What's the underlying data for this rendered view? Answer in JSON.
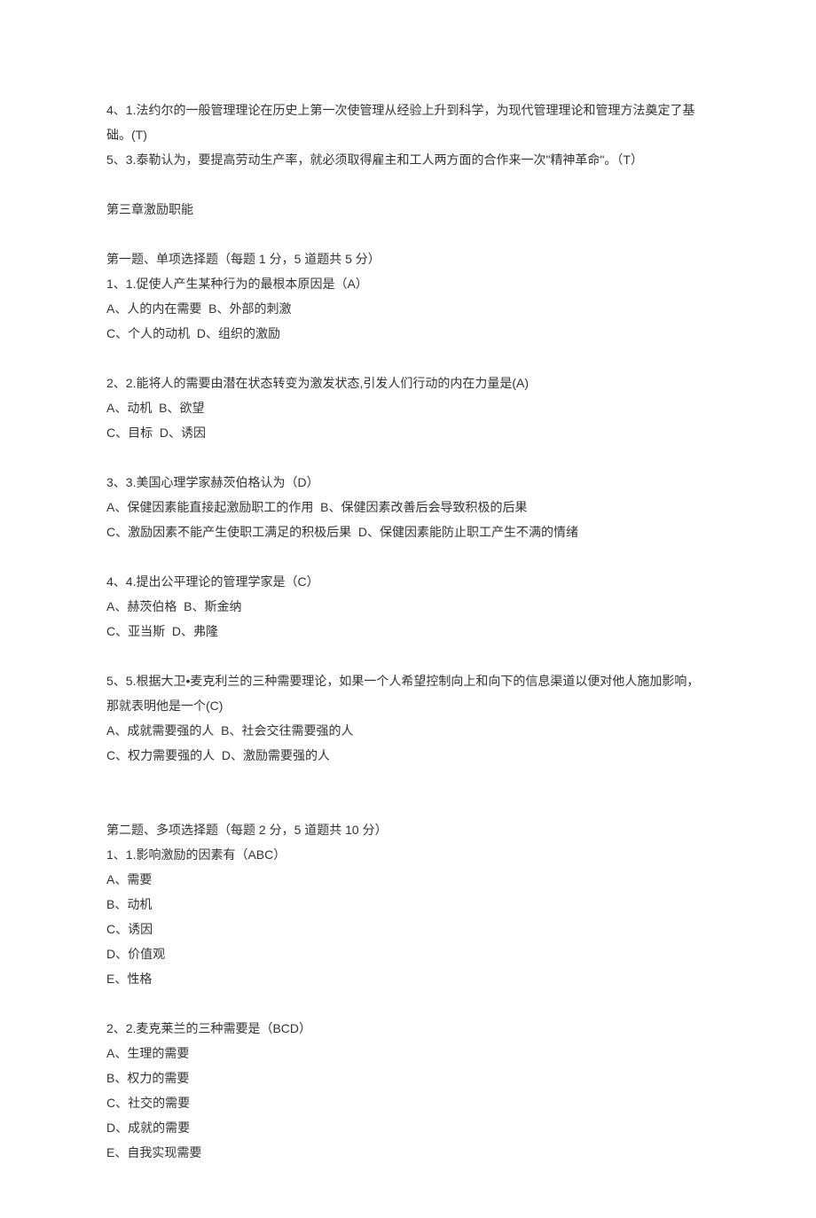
{
  "intro_lines": [
    "4、1.法约尔的一般管理理论在历史上第一次使管理从经验上升到科学，为现代管理理论和管理方法奠定了基础。(T)",
    "5、3.泰勒认为，要提高劳动生产率，就必须取得雇主和工人两方面的合作来一次\"精神革命\"。（T）"
  ],
  "chapter_title": "第三章激励职能",
  "section1": {
    "heading": "第一题、单项选择题（每题 1 分，5 道题共 5 分）",
    "q1": [
      "1、1.促使人产生某种行为的最根本原因是（A）",
      "A、人的内在需要  B、外部的刺激",
      "C、个人的动机  D、组织的激励"
    ],
    "q2": [
      "2、2.能将人的需要由潜在状态转变为激发状态,引发人们行动的内在力量是(A)",
      "A、动机  B、欲望",
      "C、目标  D、诱因"
    ],
    "q3": [
      "3、3.美国心理学家赫茨伯格认为（D）",
      "A、保健因素能直接起激励职工的作用  B、保健因素改善后会导致积极的后果",
      "C、激励因素不能产生使职工满足的积极后果  D、保健因素能防止职工产生不满的情绪"
    ],
    "q4": [
      "4、4.提出公平理论的管理学家是（C）",
      "A、赫茨伯格  B、斯金纳",
      "C、亚当斯  D、弗隆"
    ],
    "q5": [
      "5、5.根据大卫•麦克利兰的三种需要理论，如果一个人希望控制向上和向下的信息渠道以便对他人施加影响，那就表明他是一个(C)",
      "A、成就需要强的人  B、社会交往需要强的人",
      "C、权力需要强的人  D、激励需要强的人"
    ]
  },
  "section2": {
    "heading": "第二题、多项选择题（每题 2 分，5 道题共 10 分）",
    "q1": [
      "1、1.影响激励的因素有（ABC）",
      "A、需要",
      "B、动机",
      "C、诱因",
      "D、价值观",
      "E、性格"
    ],
    "q2": [
      "2、2.麦克莱兰的三种需要是（BCD）",
      "A、生理的需要",
      "B、权力的需要",
      "C、社交的需要",
      "D、成就的需要",
      "E、自我实现需要"
    ]
  }
}
